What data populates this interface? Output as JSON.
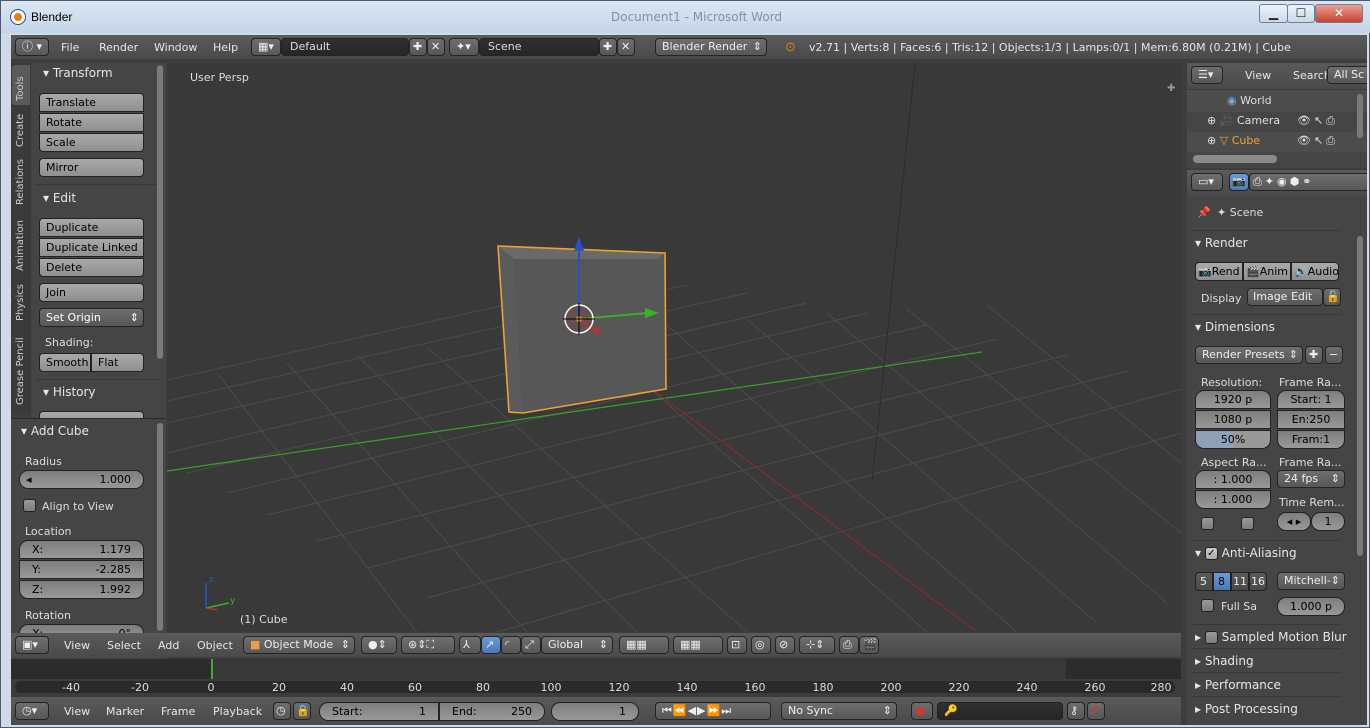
{
  "window": {
    "title": "Blender",
    "bg_title": "Document1 - Microsoft Word",
    "controls": {
      "minimize": "▁",
      "maximize": "☐",
      "close": "✕"
    }
  },
  "topbar": {
    "menus": [
      "File",
      "Render",
      "Window",
      "Help"
    ],
    "layout": "Default",
    "scene": "Scene",
    "engine": "Blender Render",
    "stats": "v2.71 | Verts:8 | Faces:6 | Tris:12 | Objects:1/3 | Lamps:0/1 | Mem:6.80M (0.21M) | Cube"
  },
  "tool_tabs": [
    "Tools",
    "Create",
    "Relations",
    "Animation",
    "Physics",
    "Grease Pencil"
  ],
  "tool_shelf": {
    "transform": {
      "title": "Transform",
      "buttons": [
        "Translate",
        "Rotate",
        "Scale",
        "Mirror"
      ]
    },
    "edit": {
      "title": "Edit",
      "buttons": [
        "Duplicate",
        "Duplicate Linked",
        "Delete",
        "Join"
      ],
      "set_origin": "Set Origin",
      "shading_label": "Shading:",
      "smooth": "Smooth",
      "flat": "Flat"
    },
    "history": {
      "title": "History"
    }
  },
  "operator": {
    "title": "Add Cube",
    "radius_label": "Radius",
    "radius": "1.000",
    "align": "Align to View",
    "location_label": "Location",
    "x_label": "X:",
    "x": "1.179",
    "y_label": "Y:",
    "y": "-2.285",
    "z_label": "Z:",
    "z": "1.992",
    "rotation_label": "Rotation",
    "rot_x_label": "X:",
    "rot_x": "0°"
  },
  "viewport": {
    "persp": "User Persp",
    "object_label": "(1) Cube"
  },
  "viewport_header": {
    "menus": [
      "View",
      "Select",
      "Add",
      "Object"
    ],
    "mode": "Object Mode",
    "orientation": "Global"
  },
  "outliner": {
    "menus": [
      "View",
      "Search"
    ],
    "filter": "All Sc",
    "items": [
      "World",
      "Camera",
      "Cube"
    ]
  },
  "properties": {
    "scene": "Scene",
    "render": {
      "title": "Render",
      "render_btn": "Rend",
      "anim_btn": "Anim",
      "audio_btn": "Audio",
      "display_label": "Display",
      "display_value": "Image Edit"
    },
    "dimensions": {
      "title": "Dimensions",
      "presets": "Render Presets",
      "resolution_label": "Resolution:",
      "frame_range_label": "Frame Ra...",
      "res_x": "1920 p",
      "res_y": "1080 p",
      "res_pct": "50%",
      "start": "Start: 1",
      "end": "En:250",
      "frame": "Fram:1",
      "aspect_label": "Aspect Ra...",
      "frame_rate_label": "Frame Ra...",
      "aspect_x": ": 1.000",
      "aspect_y": ": 1.000",
      "fps": "24 fps",
      "time_remap_label": "Time Rem...",
      "time_remap": "1"
    },
    "aa": {
      "title": "Anti-Aliasing",
      "samples": [
        "5",
        "8",
        "11",
        "16"
      ],
      "selected": "8",
      "filter": "Mitchell-",
      "full_sample": "Full Sa",
      "filter_size": "1.000 p"
    },
    "panels": [
      "Sampled Motion Blur",
      "Shading",
      "Performance",
      "Post Processing"
    ]
  },
  "timeline": {
    "ticks": [
      "-40",
      "-20",
      "0",
      "20",
      "40",
      "60",
      "80",
      "100",
      "120",
      "140",
      "160",
      "180",
      "200",
      "220",
      "240",
      "260",
      "280"
    ],
    "menus": [
      "View",
      "Marker",
      "Frame",
      "Playback"
    ],
    "start_label": "Start:",
    "start": "1",
    "end_label": "End:",
    "end": "250",
    "current": "1",
    "sync": "No Sync"
  },
  "colors": {
    "accent": "#e87d0d",
    "selected_outline": "#f0a030",
    "axis_x": "#b03030",
    "axis_y": "#3aa02a",
    "axis_z": "#2a50d0"
  }
}
